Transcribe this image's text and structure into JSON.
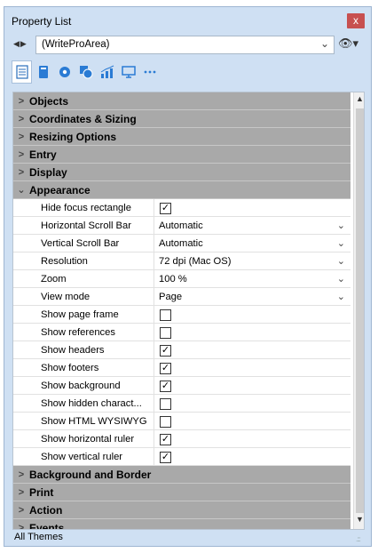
{
  "window": {
    "title": "Property List",
    "close_label": "x"
  },
  "selector": {
    "nav_label": "◀▶",
    "value": "(WriteProArea)",
    "chevron": "chevron-down-icon"
  },
  "eye_menu": {
    "icon": "eye-icon",
    "label": "👁▾"
  },
  "toolbar": {
    "tools": [
      {
        "icon": "list-icon",
        "active": true
      },
      {
        "icon": "object-icon",
        "active": false
      },
      {
        "icon": "gear-icon",
        "active": false
      },
      {
        "icon": "shapes-icon",
        "active": false
      },
      {
        "icon": "chart-icon",
        "active": false
      },
      {
        "icon": "monitor-icon",
        "active": false
      },
      {
        "icon": "more-icon",
        "active": false
      }
    ]
  },
  "sections_top": [
    {
      "label": "Objects",
      "expanded": false
    },
    {
      "label": "Coordinates & Sizing",
      "expanded": false
    },
    {
      "label": "Resizing Options",
      "expanded": false
    },
    {
      "label": "Entry",
      "expanded": false
    },
    {
      "label": "Display",
      "expanded": false
    },
    {
      "label": "Appearance",
      "expanded": true
    }
  ],
  "chevrons": {
    "collapsed": ">",
    "expanded": "⌄",
    "dropdown": "⌄"
  },
  "properties": [
    {
      "label": "Hide focus rectangle",
      "type": "checkbox",
      "checked": true
    },
    {
      "label": "Horizontal Scroll Bar",
      "type": "dropdown",
      "value": "Automatic"
    },
    {
      "label": "Vertical Scroll Bar",
      "type": "dropdown",
      "value": "Automatic"
    },
    {
      "label": "Resolution",
      "type": "dropdown",
      "value": "72 dpi (Mac OS)"
    },
    {
      "label": "Zoom",
      "type": "dropdown",
      "value": "100 %"
    },
    {
      "label": "View mode",
      "type": "dropdown",
      "value": "Page"
    },
    {
      "label": "Show page frame",
      "type": "checkbox",
      "checked": false
    },
    {
      "label": "Show references",
      "type": "checkbox",
      "checked": false
    },
    {
      "label": "Show headers",
      "type": "checkbox",
      "checked": true
    },
    {
      "label": "Show footers",
      "type": "checkbox",
      "checked": true
    },
    {
      "label": "Show background",
      "type": "checkbox",
      "checked": true
    },
    {
      "label": "Show hidden charact...",
      "type": "checkbox",
      "checked": false
    },
    {
      "label": "Show HTML WYSIWYG",
      "type": "checkbox",
      "checked": false
    },
    {
      "label": "Show horizontal ruler",
      "type": "checkbox",
      "checked": true
    },
    {
      "label": "Show vertical ruler",
      "type": "checkbox",
      "checked": true
    }
  ],
  "sections_bottom": [
    {
      "label": "Background and Border",
      "expanded": false
    },
    {
      "label": "Print",
      "expanded": false
    },
    {
      "label": "Action",
      "expanded": false
    },
    {
      "label": "Events",
      "expanded": false
    }
  ],
  "checkmark": "✓",
  "scrollbar": {
    "up": "▲",
    "down": "▼"
  },
  "status": {
    "label": "All Themes",
    "grip": ".:::"
  },
  "colors": {
    "section_bg": "#a9a9a9",
    "window_bg": "#cfe0f3",
    "close_bg": "#c75050"
  }
}
